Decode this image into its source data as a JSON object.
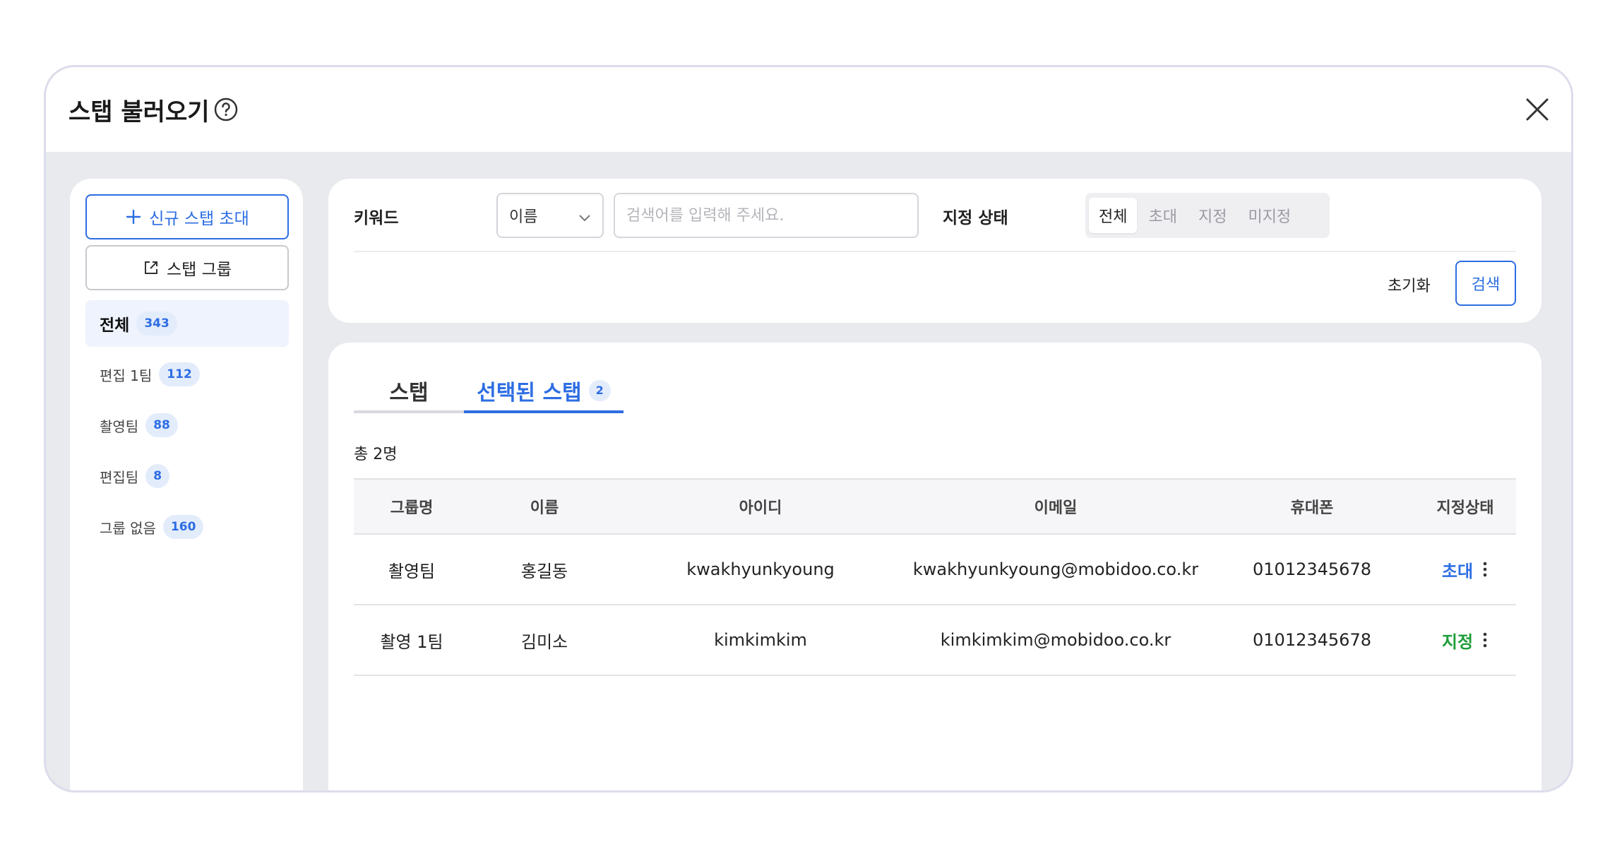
{
  "modal": {
    "title": "스탭 불러오기",
    "help_icon": "question-circle-icon",
    "close_icon": "close-icon"
  },
  "sidebar": {
    "invite_button": "신규 스탭 초대",
    "group_button": "스탭 그룹",
    "groups": [
      {
        "label": "전체",
        "count": "343",
        "active": true
      },
      {
        "label": "편집 1팀",
        "count": "112",
        "active": false
      },
      {
        "label": "촬영팀",
        "count": "88",
        "active": false
      },
      {
        "label": "편집팀",
        "count": "8",
        "active": false
      },
      {
        "label": "그룹 없음",
        "count": "160",
        "active": false
      }
    ]
  },
  "search": {
    "keyword_label": "키워드",
    "select_value": "이름",
    "input_placeholder": "검색어를 입력해 주세요.",
    "input_value": "",
    "status_label": "지정 상태",
    "status_options": [
      "전체",
      "초대",
      "지정",
      "미지정"
    ],
    "status_selected": "전체",
    "reset_label": "초기화",
    "search_label": "검색"
  },
  "results": {
    "tabs": [
      {
        "label": "스탭",
        "badge": ""
      },
      {
        "label": "선택된 스탭",
        "badge": "2"
      }
    ],
    "active_tab": "선택된 스탭",
    "total": "총 2명",
    "columns": [
      "그룹명",
      "이름",
      "아이디",
      "이메일",
      "휴대폰",
      "지정상태"
    ],
    "rows": [
      {
        "group": "촬영팀",
        "name": "홍길동",
        "id": "kwakhyunkyoung",
        "email": "kwakhyunkyoung@mobidoo.co.kr",
        "phone": "01012345678",
        "status": "초대",
        "status_color": "#2d6de3"
      },
      {
        "group": "촬영 1팀",
        "name": "김미소",
        "id": "kimkimkim",
        "email": "kimkimkim@mobidoo.co.kr",
        "phone": "01012345678",
        "status": "지정",
        "status_color": "#1f9d3a"
      }
    ]
  },
  "colors": {
    "accent": "#2d6de3",
    "assigned": "#1f9d3a",
    "panel_bg": "#e9eaee"
  }
}
